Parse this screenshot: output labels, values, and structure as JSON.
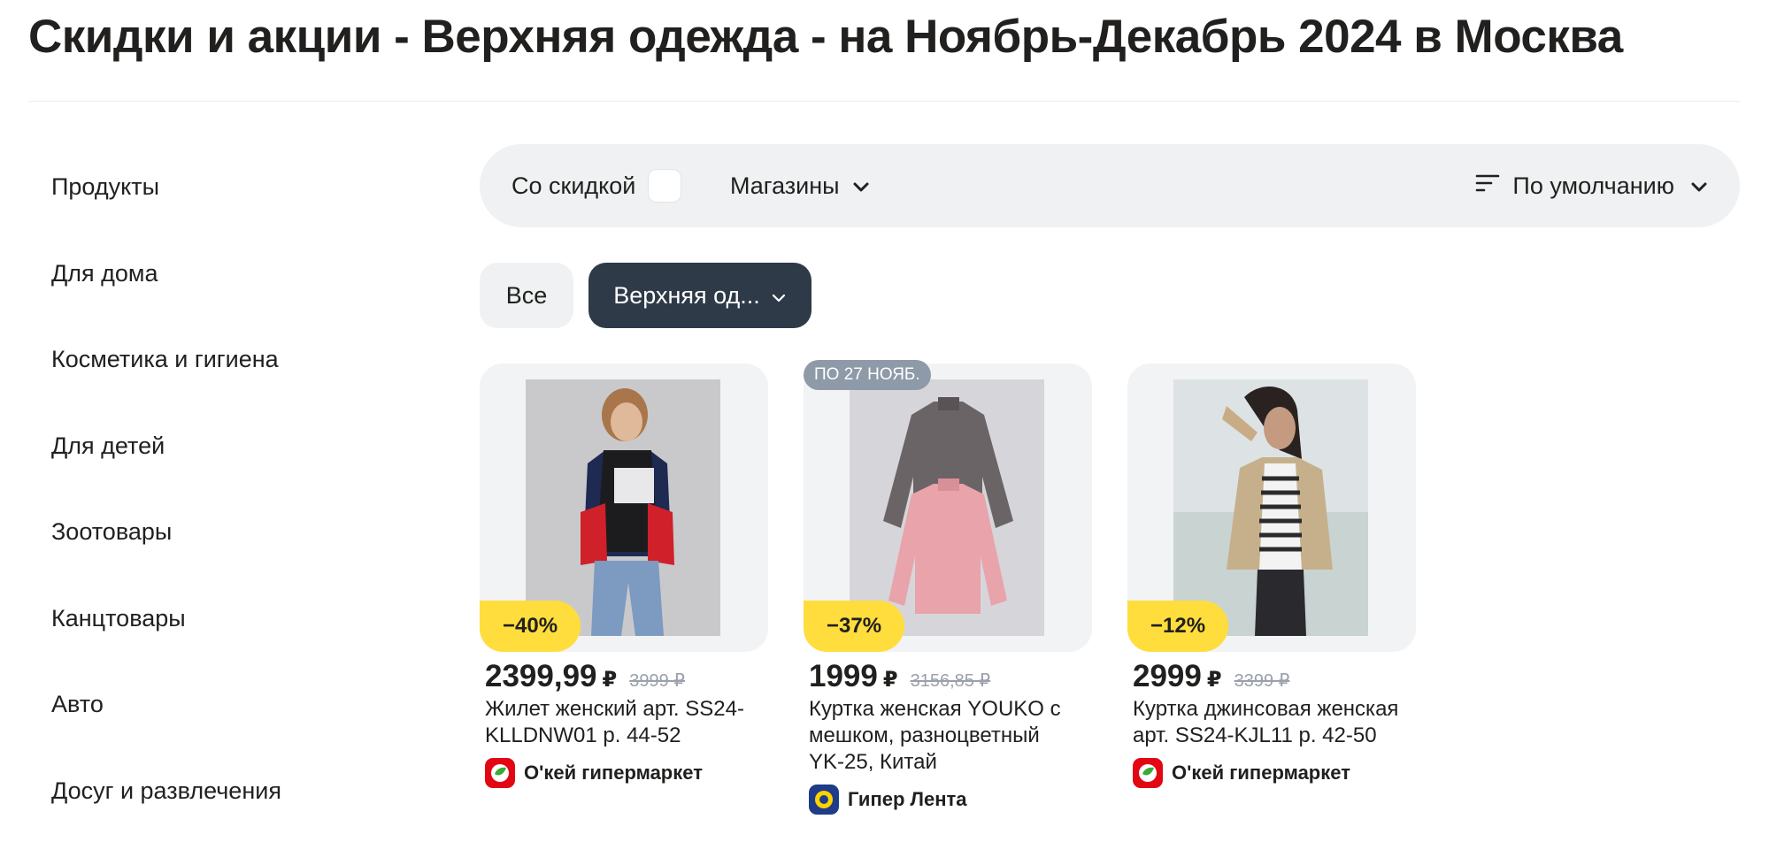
{
  "page": {
    "title": "Скидки и акции - Верхняя одежда - на Ноябрь-Декабрь 2024 в Москва"
  },
  "sidebar": {
    "items": [
      {
        "label": "Продукты"
      },
      {
        "label": "Для дома"
      },
      {
        "label": "Косметика и гигиена"
      },
      {
        "label": "Для детей"
      },
      {
        "label": "Зоотовары"
      },
      {
        "label": "Канцтовары"
      },
      {
        "label": "Авто"
      },
      {
        "label": "Досуг и развлечения"
      }
    ]
  },
  "filters": {
    "discount_label": "Со скидкой",
    "discount_checked": false,
    "stores_label": "Магазины",
    "sort_label": "По умолчанию"
  },
  "chips": {
    "all_label": "Все",
    "active_label": "Верхняя од..."
  },
  "products": [
    {
      "discount": "−40%",
      "price": "2399,99",
      "currency": "₽",
      "old_price": "3999 ₽",
      "name": "Жилет женский арт. SS24-KLLDNW01 р. 44-52",
      "store": "О'кей гипермаркет",
      "store_icon": "okey-logo-icon"
    },
    {
      "date_badge": "ПО 27 НОЯБ.",
      "discount": "−37%",
      "price": "1999",
      "currency": "₽",
      "old_price": "3156,85 ₽",
      "name": "Куртка женская YOUKO с мешком, разноцветный YK-25, Китай",
      "store": "Гипер Лента",
      "store_icon": "lenta-logo-icon"
    },
    {
      "discount": "−12%",
      "price": "2999",
      "currency": "₽",
      "old_price": "3399 ₽",
      "name": "Куртка джинсовая женская арт. SS24-KJL11 р. 42-50",
      "store": "О'кей гипермаркет",
      "store_icon": "okey-logo-icon"
    }
  ],
  "colors": {
    "accent_badge": "#ffdd3d",
    "chip_active": "#2e3a48",
    "filter_bg": "#eff1f2",
    "okey_red": "#e30613",
    "lenta_blue": "#1f3c88"
  }
}
